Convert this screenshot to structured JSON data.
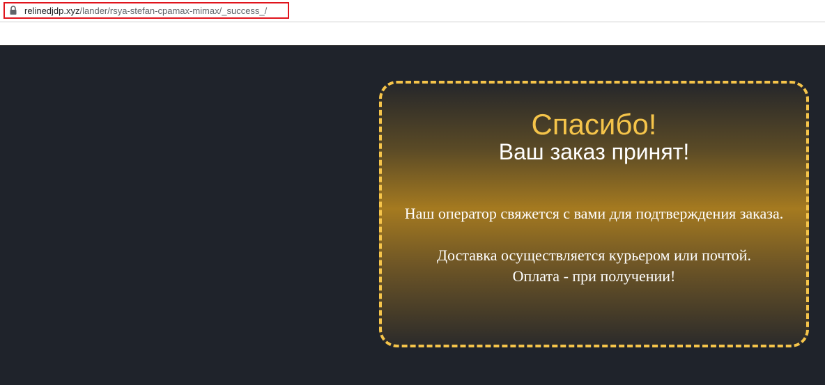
{
  "browser": {
    "url_domain": "relinedjdp.xyz",
    "url_path": "/lander/rsya-stefan-cpamax-mimax/_success_/"
  },
  "success_card": {
    "title": "Спасибо!",
    "subtitle": "Ваш заказ принят!",
    "message_1": "Наш оператор свяжется с вами для подтверждения заказа.",
    "message_2_line1": "Доставка осуществляется курьером или почтой.",
    "message_2_line2": "Оплата - при получении!"
  },
  "colors": {
    "accent": "#f5c44a",
    "background": "#1f232b",
    "url_highlight": "#e0141c"
  },
  "icons": {
    "address_bar": "lock-icon"
  }
}
